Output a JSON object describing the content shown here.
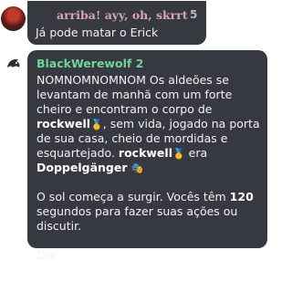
{
  "messages": [
    {
      "username": "arriba! ayy, oh, skrrt",
      "tag": "5",
      "text": "Já pode matar o Erick"
    },
    {
      "username": "BlackWerewolf 2",
      "paragraph1": {
        "intro": "NOMNOMNOMNOM Os aldeões se levantam de manhã com um forte cheiro e encontram o corpo de ",
        "victim": "rockwell",
        "medal_icon": "medal-icon",
        "mid": ", sem vida, jogado na porta de sua casa, cheio de mordidas e esquartejado. ",
        "victim_repeat": "rockwell",
        "era": " era ",
        "role": "Doppelgänger",
        "role_icon": "theater-masks-icon"
      },
      "paragraph2": {
        "prefix": "O sol começa a surgir. Vocês têm ",
        "seconds": "120",
        "suffix": " segundos para fazer suas ações ou discutir."
      },
      "paragraph3": {
        "prefix": "Dia ",
        "day": "1"
      }
    }
  ],
  "colors": {
    "bubble": "#36393f",
    "username1": "#d8a6b6",
    "username2": "#6fd39b",
    "text": "#f2f3f5"
  }
}
